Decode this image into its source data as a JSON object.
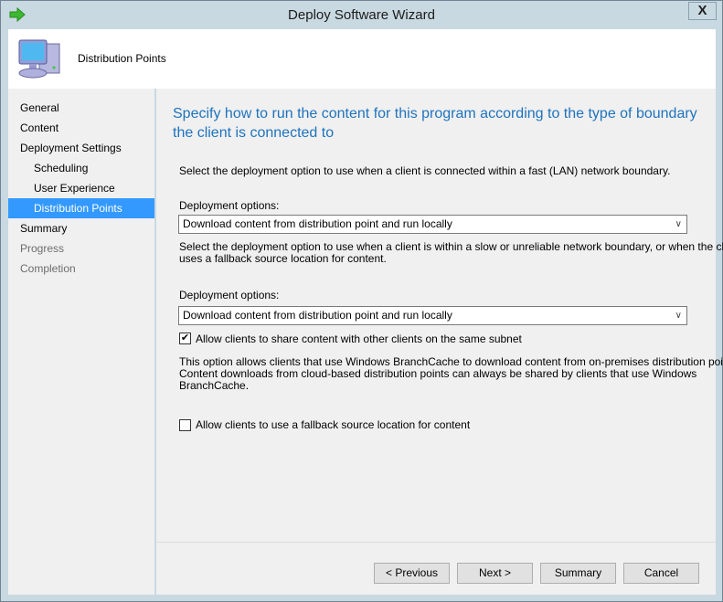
{
  "window": {
    "title": "Deploy Software Wizard",
    "close_label": "X"
  },
  "header": {
    "title": "Distribution Points"
  },
  "nav": {
    "items": [
      {
        "label": "General",
        "state": "normal"
      },
      {
        "label": "Content",
        "state": "normal"
      },
      {
        "label": "Deployment Settings",
        "state": "normal"
      },
      {
        "label": "Scheduling",
        "state": "sub"
      },
      {
        "label": "User Experience",
        "state": "sub"
      },
      {
        "label": "Distribution Points",
        "state": "selected"
      },
      {
        "label": "Summary",
        "state": "normal"
      },
      {
        "label": "Progress",
        "state": "disabled"
      },
      {
        "label": "Completion",
        "state": "disabled"
      }
    ]
  },
  "main": {
    "heading": "Specify how to run the content for this program according to the type of boundary the client is connected to",
    "fast_desc": "Select the deployment option to use when a client is connected within a fast (LAN) network boundary.",
    "fast_label": "Deployment options:",
    "fast_value": "Download content from distribution point and run locally",
    "slow_desc_1": "Select the deployment option to use when a client is within a slow or unreliable network boundary, or when the client",
    "slow_desc_2": "uses a fallback source location for content.",
    "slow_label": "Deployment options:",
    "slow_value": "Download content from distribution point and run locally",
    "share_label": "Allow clients to share content with other clients on the same subnet",
    "share_checked": true,
    "bc_1": "This option allows clients that use Windows BranchCache to download content from on-premises distribution points.",
    "bc_2": "Content downloads from cloud-based distribution points can always be shared by clients that use Windows",
    "bc_3": "BranchCache.",
    "fallback_label": "Allow clients to use a fallback source location for content",
    "fallback_checked": false
  },
  "buttons": {
    "previous": "< Previous",
    "next": "Next >",
    "summary": "Summary",
    "cancel": "Cancel"
  },
  "colors": {
    "accent": "#3399ff",
    "heading": "#1e73be"
  }
}
